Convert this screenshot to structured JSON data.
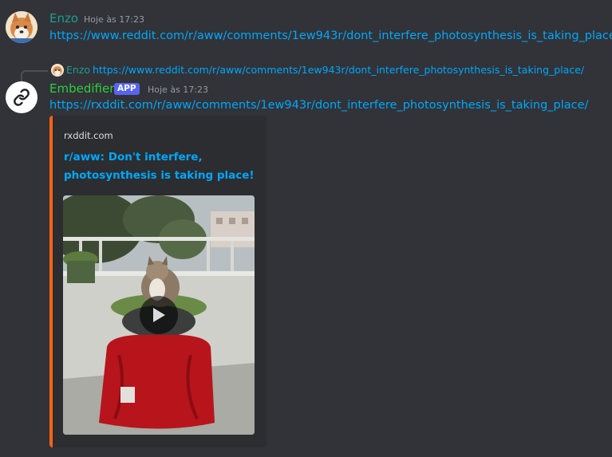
{
  "message1": {
    "author": "Enzo",
    "author_color": "#1d9e8f",
    "timestamp": "Hoje às 17:23",
    "link": "https://www.reddit.com/r/aww/comments/1ew943r/dont_interfere_photosynthesis_is_taking_place/"
  },
  "reply": {
    "author": "Enzo",
    "link": "https://www.reddit.com/r/aww/comments/1ew943r/dont_interfere_photosynthesis_is_taking_place/"
  },
  "message2": {
    "author": "Embedifier",
    "author_color": "#2fce3f",
    "badge": "APP",
    "timestamp": "Hoje às 17:23",
    "link": "https://rxddit.com/r/aww/comments/1ew943r/dont_interfere_photosynthesis_is_taking_place/",
    "icon": "link-icon"
  },
  "embed": {
    "provider": "rxddit.com",
    "title": "r/aww: Don't interfere, photosynthesis is taking place!",
    "accent_color": "#ff6314",
    "video_icon": "play-icon"
  }
}
